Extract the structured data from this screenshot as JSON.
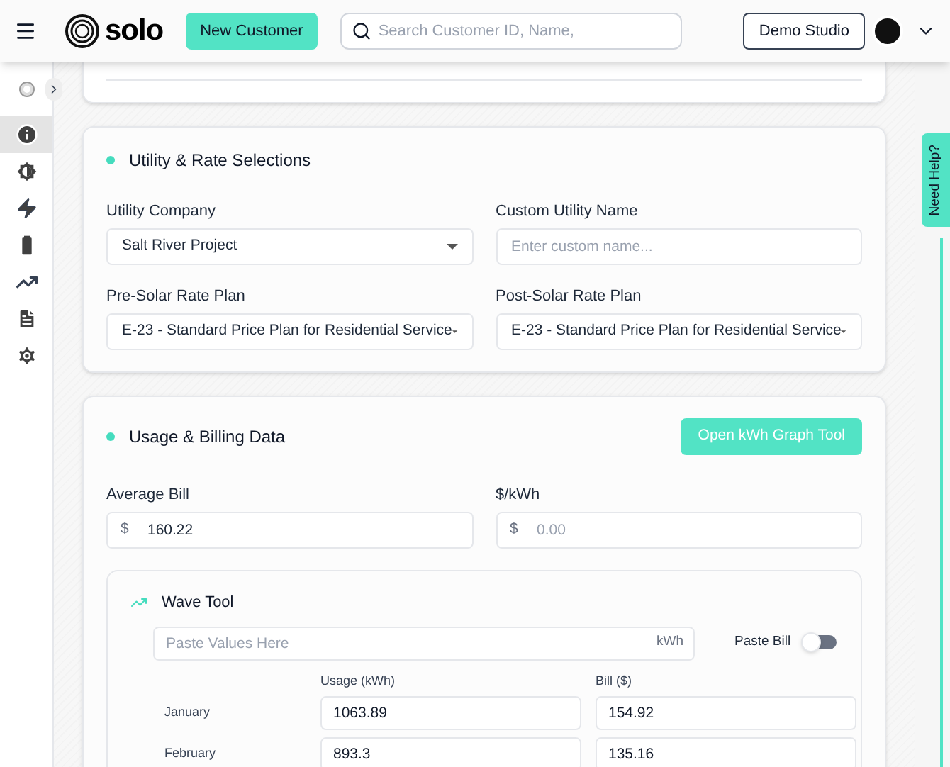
{
  "header": {
    "logo": "solo",
    "new_customer": "New Customer",
    "search": {
      "placeholder": "Search Customer ID, Name,"
    },
    "studio": "Demo Studio"
  },
  "sidebar": {
    "items": [
      {
        "kind": "info",
        "selected": true
      },
      {
        "kind": "brightness",
        "selected": false
      },
      {
        "kind": "bolt",
        "selected": false
      },
      {
        "kind": "battery",
        "selected": false
      },
      {
        "kind": "trend",
        "selected": false
      },
      {
        "kind": "document",
        "selected": false
      },
      {
        "kind": "settings",
        "selected": false
      }
    ]
  },
  "help_tab": "Need Help?",
  "utility_section": {
    "title": "Utility & Rate Selections",
    "fields": [
      {
        "kind": "select",
        "label": "Utility Company",
        "value": "Salt River Project"
      },
      {
        "kind": "input",
        "label": "Custom Utility Name",
        "placeholder": "Enter custom name..."
      },
      {
        "kind": "select",
        "label": "Pre-Solar Rate Plan",
        "value": "E-23 - Standard Price Plan for Residential Service"
      },
      {
        "kind": "select",
        "label": "Post-Solar Rate Plan",
        "value": "E-23 - Standard Price Plan for Residential Service"
      }
    ]
  },
  "usage_section": {
    "title": "Usage & Billing Data",
    "button": "Open kWh Graph Tool",
    "fields": [
      {
        "label": "Average Bill",
        "prefix": "$",
        "value": "160.22"
      },
      {
        "label": "$/kWh",
        "prefix": "$",
        "placeholder": "0.00"
      }
    ]
  },
  "wave_tool": {
    "title": "Wave Tool",
    "paste": {
      "placeholder": "Paste Values Here",
      "unit": "kWh"
    },
    "paste_bill": {
      "label": "Paste Bill",
      "on": false
    },
    "columns": [
      "Usage (kWh)",
      "Bill ($)"
    ],
    "rows": [
      {
        "month": "January",
        "usage": "1063.89",
        "bill": "154.92"
      },
      {
        "month": "February",
        "usage": "893.3",
        "bill": "135.16"
      }
    ]
  }
}
